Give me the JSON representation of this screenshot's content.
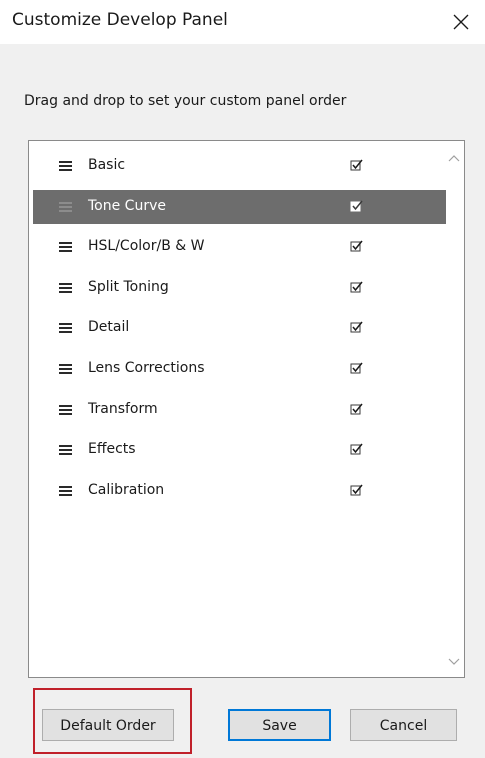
{
  "dialog": {
    "title": "Customize Develop Panel",
    "instruction": "Drag and drop to set your custom panel order"
  },
  "panels": [
    {
      "label": "Basic",
      "checked": true
    },
    {
      "label": "Tone Curve",
      "checked": true
    },
    {
      "label": "HSL/Color/B & W",
      "checked": true
    },
    {
      "label": "Split Toning",
      "checked": true
    },
    {
      "label": "Detail",
      "checked": true
    },
    {
      "label": "Lens Corrections",
      "checked": true
    },
    {
      "label": "Transform",
      "checked": true
    },
    {
      "label": "Effects",
      "checked": true
    },
    {
      "label": "Calibration",
      "checked": true
    }
  ],
  "selected_panel": "Tone Curve",
  "buttons": {
    "default_order": "Default Order",
    "save": "Save",
    "cancel": "Cancel"
  },
  "colors": {
    "selection": "#6d6d6d",
    "primary_border": "#0078d7",
    "highlight": "#c0202a"
  },
  "icons": {
    "close": "close-icon",
    "drag": "drag-handle-icon",
    "check": "checkbox-checked-icon",
    "scroll_up": "scroll-up-icon",
    "scroll_down": "scroll-down-icon"
  }
}
